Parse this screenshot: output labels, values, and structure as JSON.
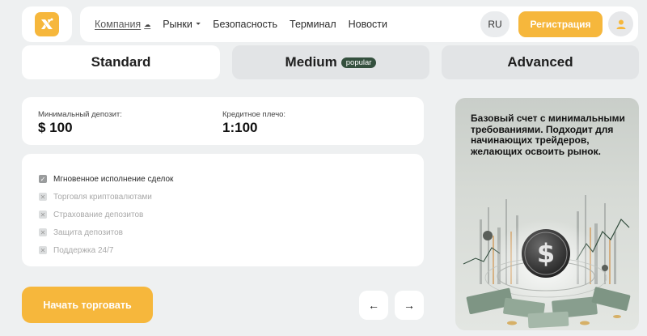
{
  "nav": {
    "links": [
      {
        "label": "Компания",
        "caret": "⌃",
        "active": true
      },
      {
        "label": "Рынки",
        "caret": "⌄"
      },
      {
        "label": "Безопасность"
      },
      {
        "label": "Терминал"
      },
      {
        "label": "Новости"
      }
    ],
    "lang": "RU",
    "register_label": "Регистрация",
    "logo_icon": "logo-icon",
    "avatar_icon": "user-icon"
  },
  "tabs": {
    "standard": "Standard",
    "medium": "Medium",
    "medium_badge": "popular",
    "advanced": "Advanced"
  },
  "stats": {
    "min_deposit_label": "Минимальный депозит:",
    "min_deposit_value": "$ 100",
    "leverage_label": "Кредитное плечо:",
    "leverage_value": "1:100"
  },
  "features": [
    {
      "label": "Мгновенное исполнение сделок",
      "enabled": true
    },
    {
      "label": "Торговля криптовалютами",
      "enabled": false
    },
    {
      "label": "Страхование депозитов",
      "enabled": false
    },
    {
      "label": "Защита депозитов",
      "enabled": false
    },
    {
      "label": "Поддержка 24/7",
      "enabled": false
    }
  ],
  "actions": {
    "start_label": "Начать торговать",
    "prev_icon": "arrow-left-icon",
    "next_icon": "arrow-right-icon"
  },
  "promo": {
    "text": "Базовый счет с минимальными требованиями. Подходит для начинающих трейдеров, желающих освоить рынок.",
    "image_icon": "dollar-coin-illustration"
  },
  "colors": {
    "accent": "#f6b73c",
    "badge": "#34503e",
    "background": "#eef0f1"
  }
}
